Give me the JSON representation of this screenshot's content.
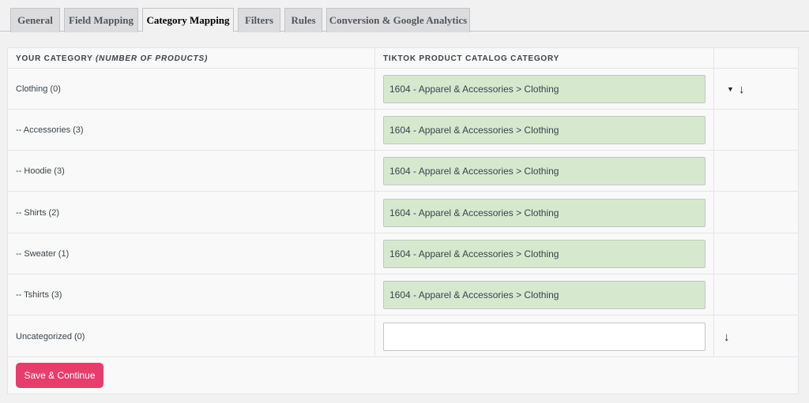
{
  "tabs": [
    {
      "label": "General"
    },
    {
      "label": "Field Mapping"
    },
    {
      "label": "Category Mapping"
    },
    {
      "label": "Filters"
    },
    {
      "label": "Rules"
    },
    {
      "label": "Conversion & Google Analytics"
    }
  ],
  "active_tab": "Category Mapping",
  "table": {
    "header_your_category": "YOUR CATEGORY",
    "header_your_category_note": "(NUMBER OF PRODUCTS)",
    "header_tiktok_category": "TIKTOK PRODUCT CATALOG CATEGORY",
    "rows": [
      {
        "category": "Clothing (0)",
        "mapping": "1604 - Apparel & Accessories > Clothing"
      },
      {
        "category": "-- Accessories (3)",
        "mapping": "1604 - Apparel & Accessories > Clothing"
      },
      {
        "category": "-- Hoodie (3)",
        "mapping": "1604 - Apparel & Accessories > Clothing"
      },
      {
        "category": "-- Shirts (2)",
        "mapping": "1604 - Apparel & Accessories > Clothing"
      },
      {
        "category": "-- Sweater (1)",
        "mapping": "1604 - Apparel & Accessories > Clothing"
      },
      {
        "category": "-- Tshirts (3)",
        "mapping": "1604 - Apparel & Accessories > Clothing"
      },
      {
        "category": "Uncategorized (0)",
        "mapping": ""
      }
    ]
  },
  "icons": {
    "caret": "caret-down-icon",
    "arrow": "arrow-down-icon"
  },
  "glyphs": {
    "caret": "▼",
    "arrow": "↓"
  },
  "save_button": {
    "label": "Save & Continue"
  },
  "colors": {
    "mapped_field_bg": "#d6e9cf",
    "save_button_bg": "#e73d6d"
  }
}
